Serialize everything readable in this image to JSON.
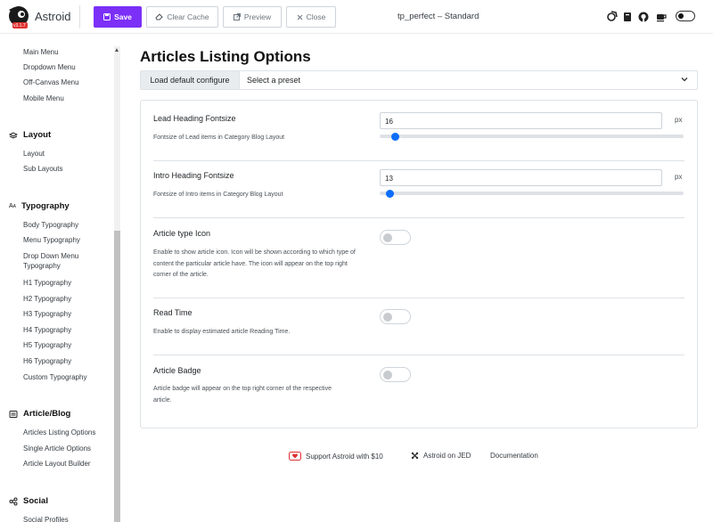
{
  "header": {
    "brand": "Astroid",
    "version": "v3.1.7",
    "buttons": {
      "save": "Save",
      "clear_cache": "Clear Cache",
      "preview": "Preview",
      "close": "Close"
    },
    "template_name": "tp_perfect – Standard",
    "icons": [
      "rocket-icon",
      "book-icon",
      "github-icon",
      "coffee-icon",
      "theme-toggle-icon"
    ]
  },
  "sidebar": {
    "top_items": [
      "Main Menu",
      "Dropdown Menu",
      "Off-Canvas Menu",
      "Mobile Menu"
    ],
    "groups": [
      {
        "title": "Layout",
        "icon": "layout-icon",
        "items": [
          "Layout",
          "Sub Layouts"
        ]
      },
      {
        "title": "Typography",
        "icon": "typography-icon",
        "items": [
          "Body Typography",
          "Menu Typography",
          "Drop Down Menu Typography",
          "H1 Typography",
          "H2 Typography",
          "H3 Typography",
          "H4 Typography",
          "H5 Typography",
          "H6 Typography",
          "Custom Typography"
        ]
      },
      {
        "title": "Article/Blog",
        "icon": "article-icon",
        "items": [
          "Articles Listing Options",
          "Single Article Options",
          "Article Layout Builder"
        ]
      },
      {
        "title": "Social",
        "icon": "share-icon",
        "items": [
          "Social Profiles"
        ]
      }
    ]
  },
  "main": {
    "title": "Articles Listing Options",
    "preset": {
      "button": "Load default configure",
      "select_value": "Select a preset"
    },
    "fields": {
      "lead_heading": {
        "label": "Lead Heading Fontsize",
        "desc": "Fontsize of Lead items in Category Blog Layout",
        "value": "16",
        "unit": "px",
        "slider_fraction": 0.04
      },
      "intro_heading": {
        "label": "Intro Heading Fontsize",
        "desc": "Fontsize of Intro items in Category Blog Layout",
        "value": "13",
        "unit": "px",
        "slider_fraction": 0.02
      },
      "type_icon": {
        "label": "Article type Icon",
        "desc": "Enable to show article icon. Icon will be shown according to which type of content the particular article have. The icon will appear on the top right corner of the article.",
        "enabled": false
      },
      "read_time": {
        "label": "Read Time",
        "desc": "Enable to display estimated article Reading Time.",
        "enabled": false
      },
      "badge": {
        "label": "Article Badge",
        "desc": "Article badge will appear on the top right corner of the respective article.",
        "enabled": false
      }
    }
  },
  "footer": {
    "support": "Support Astroid with $10",
    "jed": "Astroid on JED",
    "docs": "Documentation"
  },
  "colors": {
    "accent": "#7b2ff7",
    "slider": "#0d6efd"
  }
}
